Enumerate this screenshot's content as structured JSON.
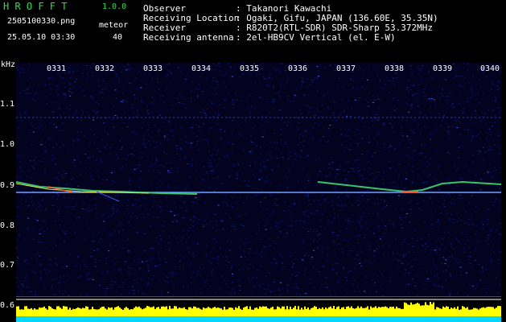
{
  "app": {
    "title": "H R O F F T",
    "version": "1.0.0",
    "filename": "2505100330.png",
    "datetime": "25.05.10 03:30",
    "count_label": "meteor",
    "count_value": "40"
  },
  "info": {
    "labels": [
      "Observer",
      "Receiving Location",
      "Receiver",
      "Receiving antenna"
    ],
    "values": [
      ": Takanori Kawachi",
      ": Ogaki, Gifu, JAPAN (136.60E, 35.35N)",
      ": R820T2(RTL-SDR) SDR-Sharp 53.372MHz",
      ": 2el-HB9CV Vertical (el. E-W)"
    ]
  },
  "axis": {
    "unit": "kHz",
    "y_ticks": [
      "1.1",
      "1.0",
      "0.9",
      "0.8",
      "0.7",
      "0.6"
    ],
    "x_ticks": [
      "0331",
      "0332",
      "0333",
      "0334",
      "0335",
      "0336",
      "0337",
      "0338",
      "0339",
      "0340"
    ]
  },
  "colors": {
    "background": "#000000",
    "noise": "#0a0a5a",
    "label_green": "#22e34a",
    "level_yellow": "#ffff00",
    "level_cyan": "#00d8ff"
  }
}
